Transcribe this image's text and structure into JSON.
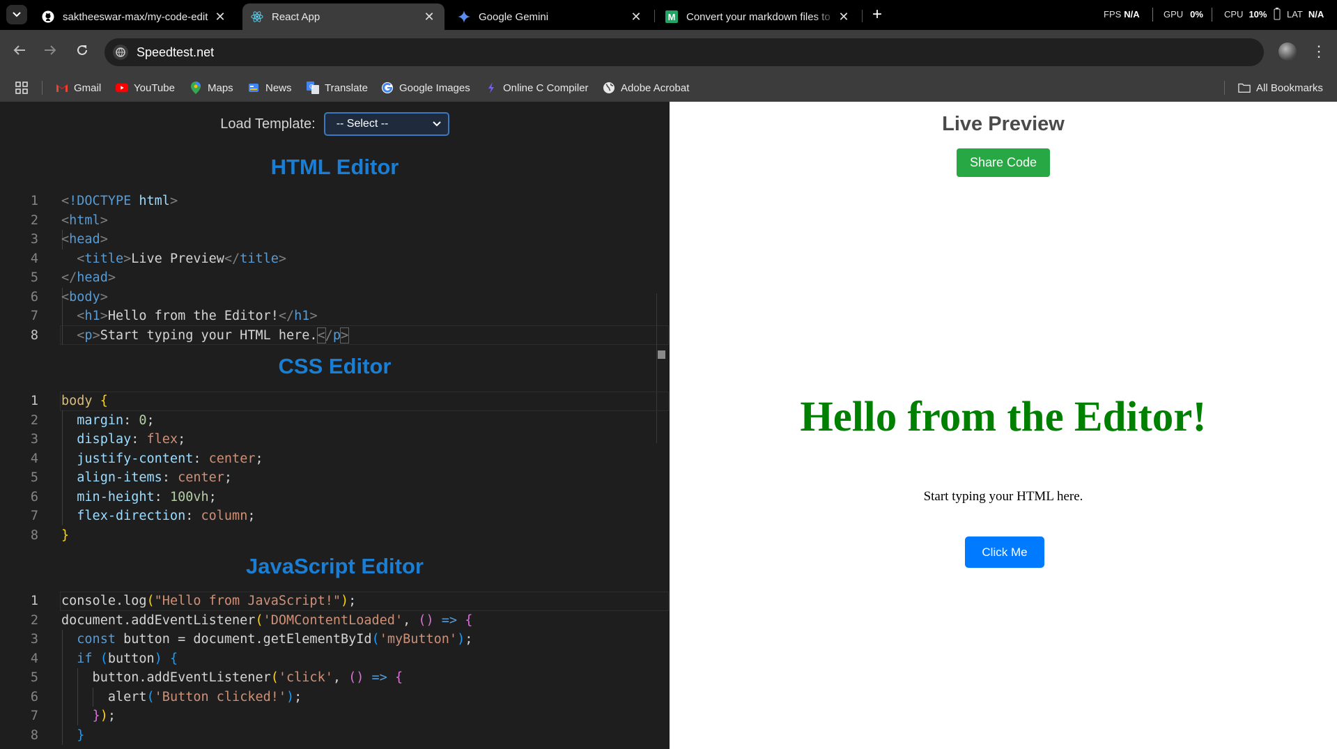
{
  "browser": {
    "tabs": [
      {
        "title": "saktheeswar-max/my-code-edit",
        "active": false,
        "icon": "github-icon"
      },
      {
        "title": "React App",
        "active": true,
        "icon": "react-icon"
      },
      {
        "title": "Google Gemini",
        "active": false,
        "icon": "gemini-icon"
      },
      {
        "title": "Convert your markdown files to",
        "active": false,
        "icon": "markdown-m-icon"
      }
    ],
    "stats": {
      "fps_label": "FPS",
      "fps_value": "N/A",
      "gpu_label": "GPU",
      "gpu_value": "0%",
      "cpu_label": "CPU",
      "cpu_value": "10%",
      "lat_label": "LAT",
      "lat_value": "N/A"
    },
    "url": "Speedtest.net",
    "bookmarks": [
      "Gmail",
      "YouTube",
      "Maps",
      "News",
      "Translate",
      "Google Images",
      "Online C Compiler",
      "Adobe Acrobat"
    ],
    "all_bookmarks": "All Bookmarks"
  },
  "editor": {
    "template_label": "Load Template:",
    "template_value": "-- Select --",
    "html_title": "HTML Editor",
    "css_title": "CSS Editor",
    "js_title": "JavaScript Editor",
    "html_lines": [
      "<!DOCTYPE html>",
      "<html>",
      "<head>",
      "  <title>Live Preview</title>",
      "</head>",
      "<body>",
      "  <h1>Hello from the Editor!</h1>",
      "  <p>Start typing your HTML here.</p>"
    ],
    "css_lines": [
      "body {",
      "  margin: 0;",
      "  display: flex;",
      "  justify-content: center;",
      "  align-items: center;",
      "  min-height: 100vh;",
      "  flex-direction: column;",
      "}"
    ],
    "js_lines": [
      "console.log(\"Hello from JavaScript!\");",
      "document.addEventListener('DOMContentLoaded', () => {",
      "  const button = document.getElementById('myButton');",
      "  if (button) {",
      "    button.addEventListener('click', () => {",
      "      alert('Button clicked!');",
      "    });",
      "  }"
    ]
  },
  "preview": {
    "title": "Live Preview",
    "share_label": "Share Code",
    "heading": "Hello from the Editor!",
    "paragraph": "Start typing your HTML here.",
    "button_label": "Click Me"
  },
  "colors": {
    "accent_blue": "#1a7fd4",
    "share_green": "#28a745",
    "heading_green": "#008000",
    "button_blue": "#007bff"
  }
}
